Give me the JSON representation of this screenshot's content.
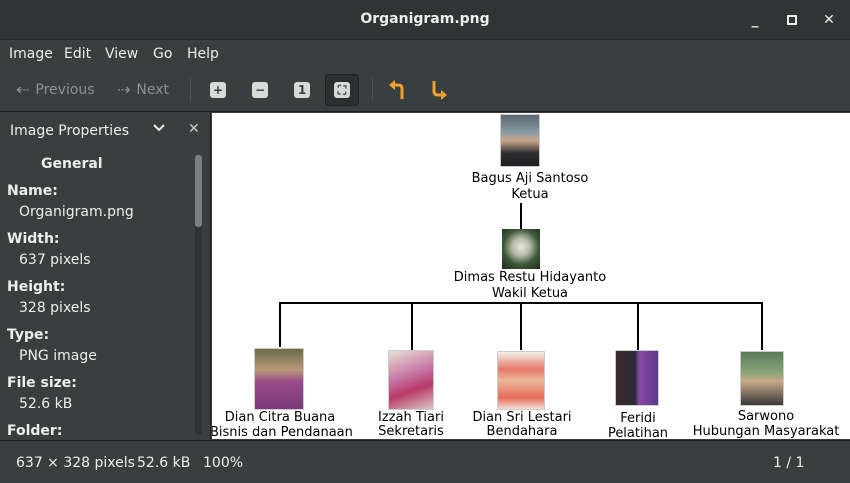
{
  "window": {
    "title": "Organigram.png"
  },
  "menu": {
    "items": [
      "Image",
      "Edit",
      "View",
      "Go",
      "Help"
    ]
  },
  "toolbar": {
    "previous_label": "Previous",
    "next_label": "Next"
  },
  "sidebar": {
    "title": "Image Properties",
    "section": "General",
    "props": [
      {
        "label": "Name:",
        "value": "Organigram.png"
      },
      {
        "label": "Width:",
        "value": "637 pixels"
      },
      {
        "label": "Height:",
        "value": "328 pixels"
      },
      {
        "label": "Type:",
        "value": "PNG image"
      },
      {
        "label": "File size:",
        "value": "52.6 kB"
      },
      {
        "label": "Folder:",
        "value": ""
      }
    ]
  },
  "chart": {
    "top": {
      "name": "Bagus Aji Santoso",
      "role": "Ketua"
    },
    "second": {
      "name": "Dimas Restu Hidayanto",
      "role": "Wakil Ketua"
    },
    "members": [
      {
        "name": "Dian Citra Buana",
        "role": "Bisnis dan Pendanaan"
      },
      {
        "name": "Izzah Tiari",
        "role": "Sekretaris"
      },
      {
        "name": "Dian Sri Lestari",
        "role": "Bendahara"
      },
      {
        "name": "Feridi",
        "role": "Pelatihan"
      },
      {
        "name": "Sarwono",
        "role": "Hubungan Masyarakat"
      }
    ]
  },
  "status": {
    "dimensions": "637 × 328 pixels",
    "size": "52.6 kB",
    "zoom": "100%",
    "page": "1 / 1"
  },
  "colors": {
    "window_bg": "#393f3f",
    "titlebar_bg": "#2f3434",
    "accent_arrows": "#f0a030"
  }
}
